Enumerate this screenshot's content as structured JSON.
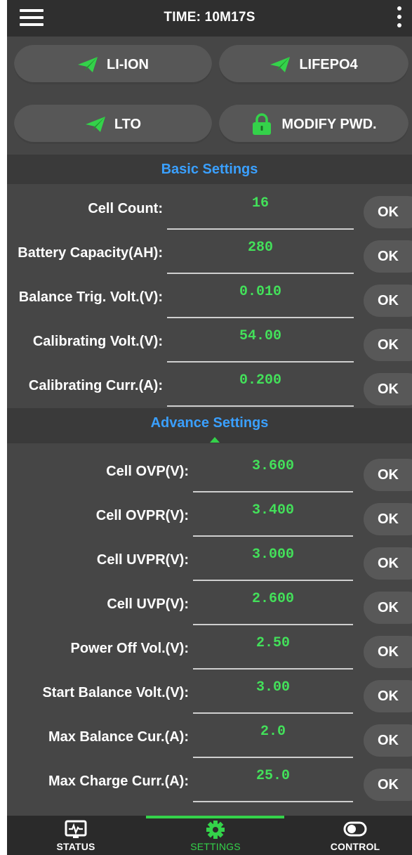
{
  "header": {
    "title": "TIME: 10M17S"
  },
  "presets": [
    {
      "label": "LI-ION",
      "icon": "paper-plane-icon"
    },
    {
      "label": "LIFEPO4",
      "icon": "paper-plane-icon"
    },
    {
      "label": "LTO",
      "icon": "paper-plane-icon"
    },
    {
      "label": "MODIFY PWD.",
      "icon": "lock-icon"
    }
  ],
  "basic": {
    "title": "Basic Settings",
    "rows": [
      {
        "label": "Cell Count:",
        "value": "16",
        "ok": "OK"
      },
      {
        "label": "Battery Capacity(AH):",
        "value": "280",
        "ok": "OK"
      },
      {
        "label": "Balance Trig. Volt.(V):",
        "value": "0.010",
        "ok": "OK"
      },
      {
        "label": "Calibrating Volt.(V):",
        "value": "54.00",
        "ok": "OK"
      },
      {
        "label": "Calibrating Curr.(A):",
        "value": "0.200",
        "ok": "OK"
      }
    ]
  },
  "advance": {
    "title": "Advance Settings",
    "rows": [
      {
        "label": "Cell OVP(V):",
        "value": "3.600",
        "ok": "OK"
      },
      {
        "label": "Cell OVPR(V):",
        "value": "3.400",
        "ok": "OK"
      },
      {
        "label": "Cell UVPR(V):",
        "value": "3.000",
        "ok": "OK"
      },
      {
        "label": "Cell UVP(V):",
        "value": "2.600",
        "ok": "OK"
      },
      {
        "label": "Power Off Vol.(V):",
        "value": "2.50",
        "ok": "OK"
      },
      {
        "label": "Start Balance Volt.(V):",
        "value": "3.00",
        "ok": "OK"
      },
      {
        "label": "Max Balance Cur.(A):",
        "value": "2.0",
        "ok": "OK"
      },
      {
        "label": "Max Charge Curr.(A):",
        "value": "25.0",
        "ok": "OK"
      }
    ]
  },
  "nav": [
    {
      "label": "STATUS",
      "icon": "monitor-icon",
      "active": false
    },
    {
      "label": "SETTINGS",
      "icon": "gear-icon",
      "active": true
    },
    {
      "label": "CONTROL",
      "icon": "toggle-icon",
      "active": false
    }
  ],
  "colors": {
    "accent": "#34d24a",
    "section_title": "#3aa0ff",
    "value": "#43e05a",
    "background": "#464646"
  }
}
